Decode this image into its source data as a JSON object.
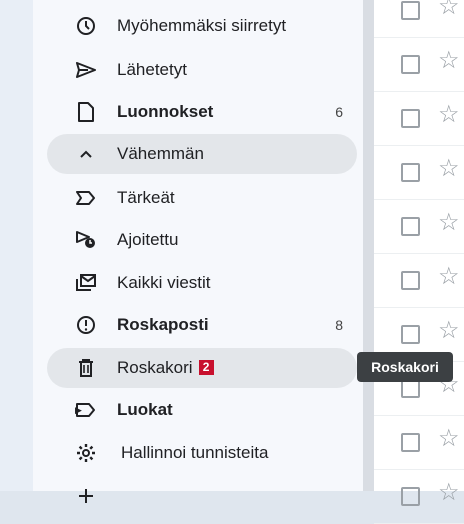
{
  "nav": {
    "snoozed": "Myöhemmäksi siirretyt",
    "sent": "Lähetetyt",
    "drafts": "Luonnokset",
    "drafts_count": "6",
    "less": "Vähemmän",
    "important": "Tärkeät",
    "scheduled": "Ajoitettu",
    "all_mail": "Kaikki viestit",
    "spam": "Roskaposti",
    "spam_count": "8",
    "trash": "Roskakori",
    "trash_badge": "2",
    "labels": "Luokat",
    "manage_labels": "Hallinnoi tunnisteita"
  },
  "tooltip": {
    "text": "Roskakori"
  },
  "colors": {
    "sidebar_bg": "#f6f8fc",
    "pill_bg": "#e3e6ea",
    "badge": "#c8102e",
    "tooltip_bg": "#3c4043"
  }
}
